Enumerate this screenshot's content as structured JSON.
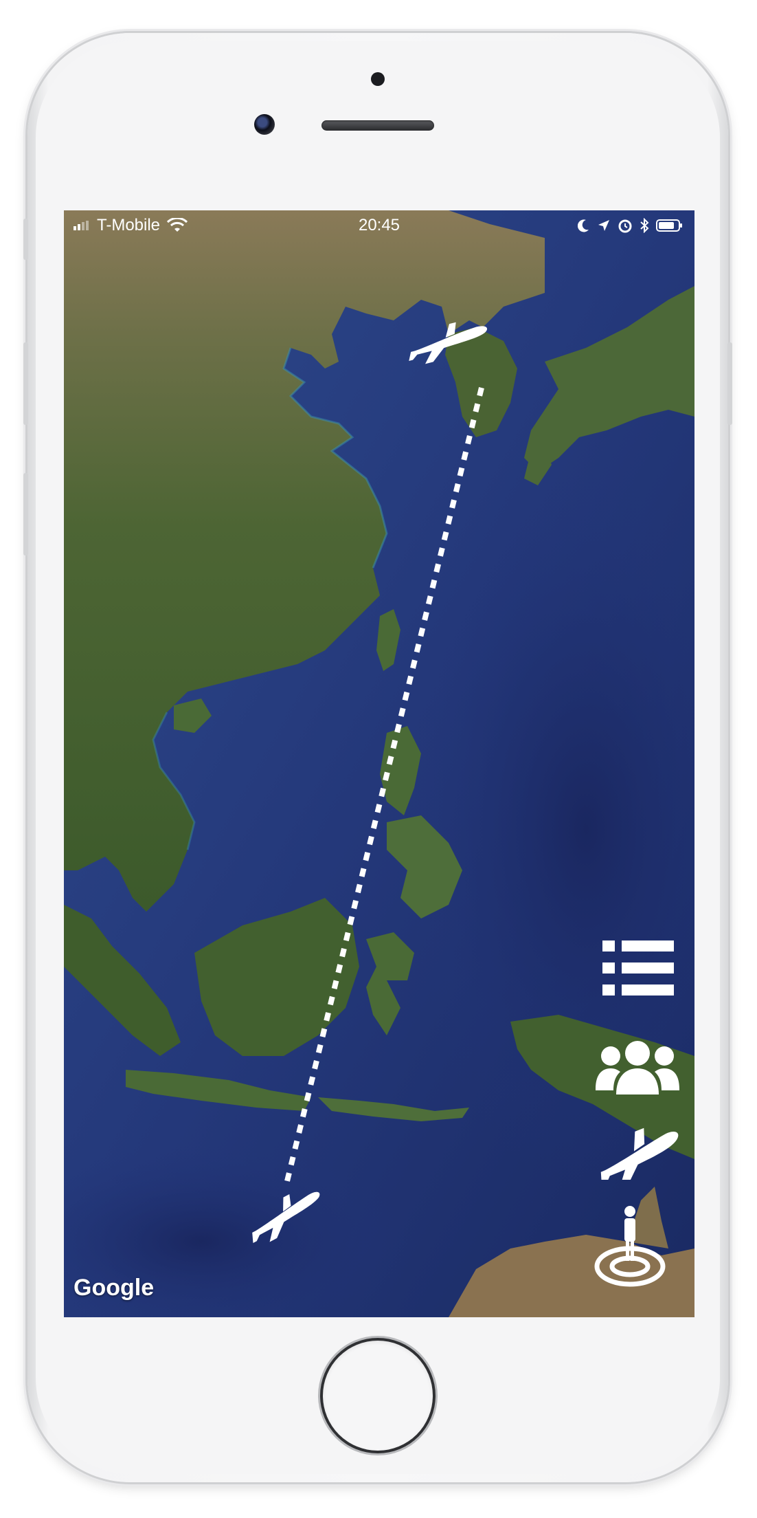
{
  "status_bar": {
    "carrier": "T-Mobile",
    "time": "20:45"
  },
  "map": {
    "attribution": "Google",
    "route": {
      "line_color": "#ffffff",
      "style": "dotted"
    }
  },
  "controls": [
    {
      "name": "list-icon"
    },
    {
      "name": "group-icon"
    },
    {
      "name": "airplane-icon"
    },
    {
      "name": "my-location-icon"
    }
  ],
  "colors": {
    "ocean": "#243a7a",
    "land": "#3f5a2c",
    "icon": "#ffffff"
  }
}
